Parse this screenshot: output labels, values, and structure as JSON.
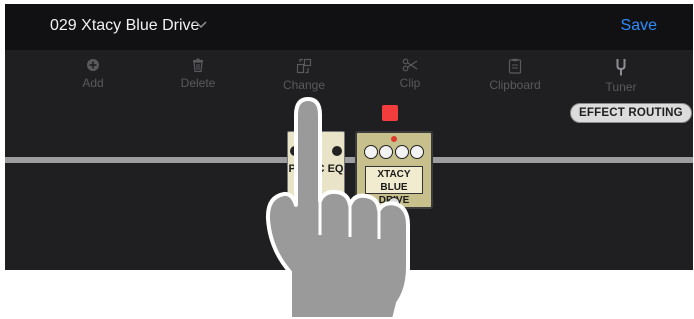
{
  "header": {
    "preset_name": "029 Xtacy Blue Drive",
    "save_label": "Save"
  },
  "toolbar": {
    "add_label": "Add",
    "delete_label": "Delete",
    "change_label": "Change",
    "clip_label": "Clip",
    "clipboard_label": "Clipboard",
    "tuner_label": "Tuner"
  },
  "routing": {
    "button_label": "EFFECT ROUTING"
  },
  "pedals": {
    "peq_label": "PA    RIC EQ",
    "drive_label": "XTACY BLUE DRIVE"
  },
  "colors": {
    "accent": "#2f8cff",
    "record": "#f33d3d",
    "background": "#1f1f21",
    "topbar": "#111113"
  },
  "icons": {
    "add": "plus-circle-icon",
    "delete": "trash-icon",
    "change": "swap-icon",
    "clip": "scissors-icon",
    "clipboard": "clipboard-icon",
    "tuner": "tuning-fork-icon",
    "chevron": "chevron-down-icon"
  }
}
